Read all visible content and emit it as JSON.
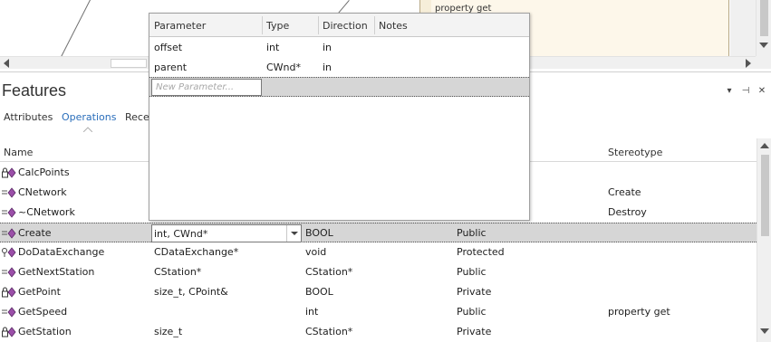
{
  "diagram": {
    "class_text": "property get"
  },
  "features_panel": {
    "title": "Features",
    "window_buttons": {
      "menu": "▾",
      "pin": "⊣",
      "close": "✕"
    },
    "tabs": [
      {
        "label": "Attributes",
        "active": false
      },
      {
        "label": "Operations",
        "active": true
      },
      {
        "label": "Rece",
        "active": false
      }
    ]
  },
  "grid": {
    "columns": {
      "name": "Name",
      "parameters": "",
      "return_type": "",
      "scope": "",
      "stereotype": "Stereotype"
    },
    "rows": [
      {
        "icon": "lock-method-icon",
        "name": "CalcPoints",
        "parameters": "",
        "return_type": "",
        "scope": "",
        "stereotype": ""
      },
      {
        "icon": "public-method-icon",
        "name": "CNetwork",
        "parameters": "",
        "return_type": "",
        "scope": "",
        "stereotype": "Create"
      },
      {
        "icon": "public-method-icon",
        "name": "~CNetwork",
        "parameters": "",
        "return_type": "",
        "scope": "",
        "stereotype": "Destroy"
      },
      {
        "icon": "public-method-icon",
        "name": "Create",
        "parameters": "int, CWnd*",
        "return_type": "BOOL",
        "scope": "Public",
        "stereotype": "",
        "selected": true
      },
      {
        "icon": "protected-method-icon",
        "name": "DoDataExchange",
        "parameters": "CDataExchange*",
        "return_type": "void",
        "scope": "Protected",
        "stereotype": ""
      },
      {
        "icon": "public-method-icon",
        "name": "GetNextStation",
        "parameters": "CStation*",
        "return_type": "CStation*",
        "scope": "Public",
        "stereotype": ""
      },
      {
        "icon": "lock-method-icon",
        "name": "GetPoint",
        "parameters": "size_t, CPoint&",
        "return_type": "BOOL",
        "scope": "Private",
        "stereotype": ""
      },
      {
        "icon": "public-method-icon",
        "name": "GetSpeed",
        "parameters": "",
        "return_type": "int",
        "scope": "Public",
        "stereotype": "property get"
      },
      {
        "icon": "lock-method-icon",
        "name": "GetStation",
        "parameters": "size_t",
        "return_type": "CStation*",
        "scope": "Private",
        "stereotype": ""
      }
    ]
  },
  "param_popup": {
    "columns": {
      "parameter": "Parameter",
      "type": "Type",
      "direction": "Direction",
      "notes": "Notes"
    },
    "rows": [
      {
        "parameter": "offset",
        "type": "int",
        "direction": "in",
        "notes": ""
      },
      {
        "parameter": "parent",
        "type": "CWnd*",
        "direction": "in",
        "notes": ""
      }
    ],
    "new_placeholder": "New Parameter..."
  },
  "colors": {
    "accent": "#2a6ebb",
    "method_icon": "#9b4fa8",
    "selection": "#d6d6d6"
  }
}
